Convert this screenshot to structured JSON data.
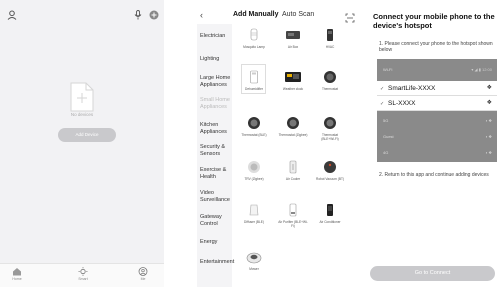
{
  "panel1": {
    "empty_title": "No devices",
    "add_button": "Add Device",
    "tabs": [
      {
        "label": "Home",
        "icon": "home-icon"
      },
      {
        "label": "Smart",
        "icon": "sun-icon"
      },
      {
        "label": "Me",
        "icon": "person-icon"
      }
    ]
  },
  "panel2": {
    "tab_manual": "Add Manually",
    "tab_auto": "Auto Scan",
    "categories": [
      "Electrician",
      "Lighting",
      "Large Home Appliances",
      "Small Home Appliances",
      "Kitchen Appliances",
      "Security & Sensors",
      "Exercise & Health",
      "Video Surveillance",
      "Gateway Control",
      "Energy",
      "Entertainment"
    ],
    "devices": [
      "Mosquito Lamp",
      "Air Box",
      "HVAC",
      "Dehumidifier",
      "Weather clock",
      "Thermostat",
      "Thermostat (BLE)",
      "Thermostat (Zigbee)",
      "Thermostat (BLE+Wi-Fi)",
      "TRV (Zigbee)",
      "Air Cooler",
      "Robot Vacuum (BT)",
      "Diffuser (BLE)",
      "Air Purifier (BLE+Wi-Fi)",
      "Air Conditioner",
      "Mower"
    ]
  },
  "panel3": {
    "title": "Connect your mobile phone to the device's hotspot",
    "step1": "1. Please connect your phone to the hotspot shown below",
    "wifi_top": "Wi-Fi",
    "hotspots": [
      "SmartLife-XXXX",
      "SL-XXXX"
    ],
    "other_networks": [
      "5G",
      "Guest",
      "4G"
    ],
    "step2": "2. Return to this app and continue adding devices",
    "connect_button": "Go to Connect"
  },
  "colors": {
    "button_gray": "#c9c9cc",
    "side_bg": "#f4f4f6",
    "wifi_gray": "#8a8a8a"
  }
}
